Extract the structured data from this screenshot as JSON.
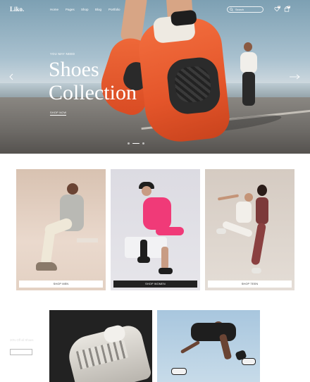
{
  "brand": {
    "logo": "Liko."
  },
  "nav": {
    "links": [
      "Home",
      "Pages",
      "Shop",
      "Blog",
      "Portfolio"
    ],
    "search_placeholder": "Search",
    "wishlist_count": "0",
    "cart_count": "0"
  },
  "hero": {
    "eyebrow": "YOU MAY NEED",
    "title_line1": "Shoes",
    "title_line2": "Collection",
    "button": "SHOP NOW",
    "slides": 3,
    "active_slide": 1
  },
  "categories": [
    {
      "button": "SHOP MEN",
      "style": "light"
    },
    {
      "button": "SHOP WOMEN",
      "style": "dark"
    },
    {
      "button": "SHOP TEEN",
      "style": "light"
    }
  ],
  "promo": {
    "sale_title": "Sale",
    "sale_subtitle": "20% Off all Shoes",
    "sale_button": "SHOP NOW"
  },
  "colors": {
    "accent_shoe": "#e4552a",
    "dark": "#222222",
    "white": "#ffffff"
  }
}
